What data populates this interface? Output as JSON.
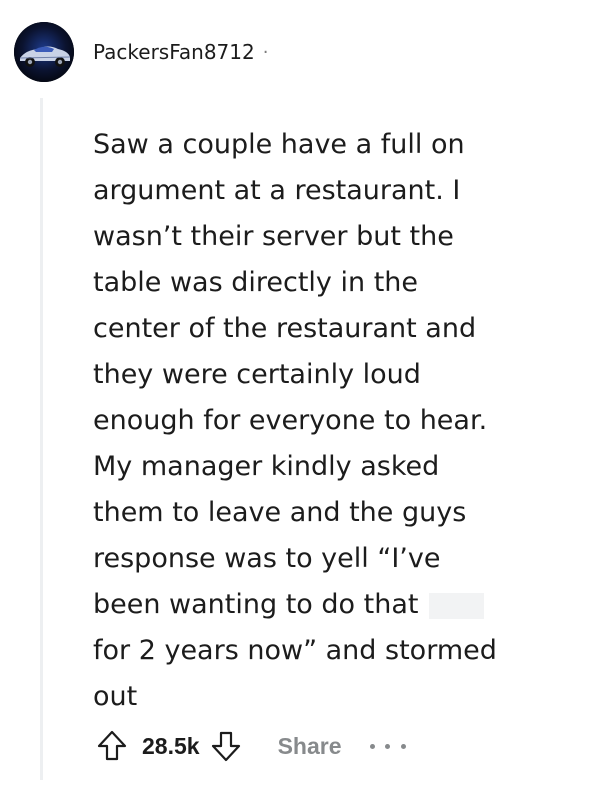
{
  "comment": {
    "username": "PackersFan8712",
    "separator": "·",
    "avatar_icon": "car-avatar-icon",
    "body_lines": [
      "Saw a couple have a full on",
      "argument at a restaurant. I",
      "wasn’t their server but the",
      "table was directly in the",
      "center of the restaurant and",
      "they were certainly loud",
      "enough for everyone to hear.",
      "My manager kindly asked",
      "them to leave and the guys",
      "response was to yell “I’ve",
      "been wanting to do that",
      "for 2 years now” and stormed",
      "out"
    ]
  },
  "actions": {
    "upvote_icon": "upvote-arrow-icon",
    "score": "28.5k",
    "downvote_icon": "downvote-arrow-icon",
    "share_label": "Share",
    "more_icon": "more-options-icon"
  },
  "colors": {
    "text": "#1c1c1c",
    "muted": "#878a8c",
    "thread_line": "#edeff1",
    "redaction": "#f2f3f4"
  }
}
